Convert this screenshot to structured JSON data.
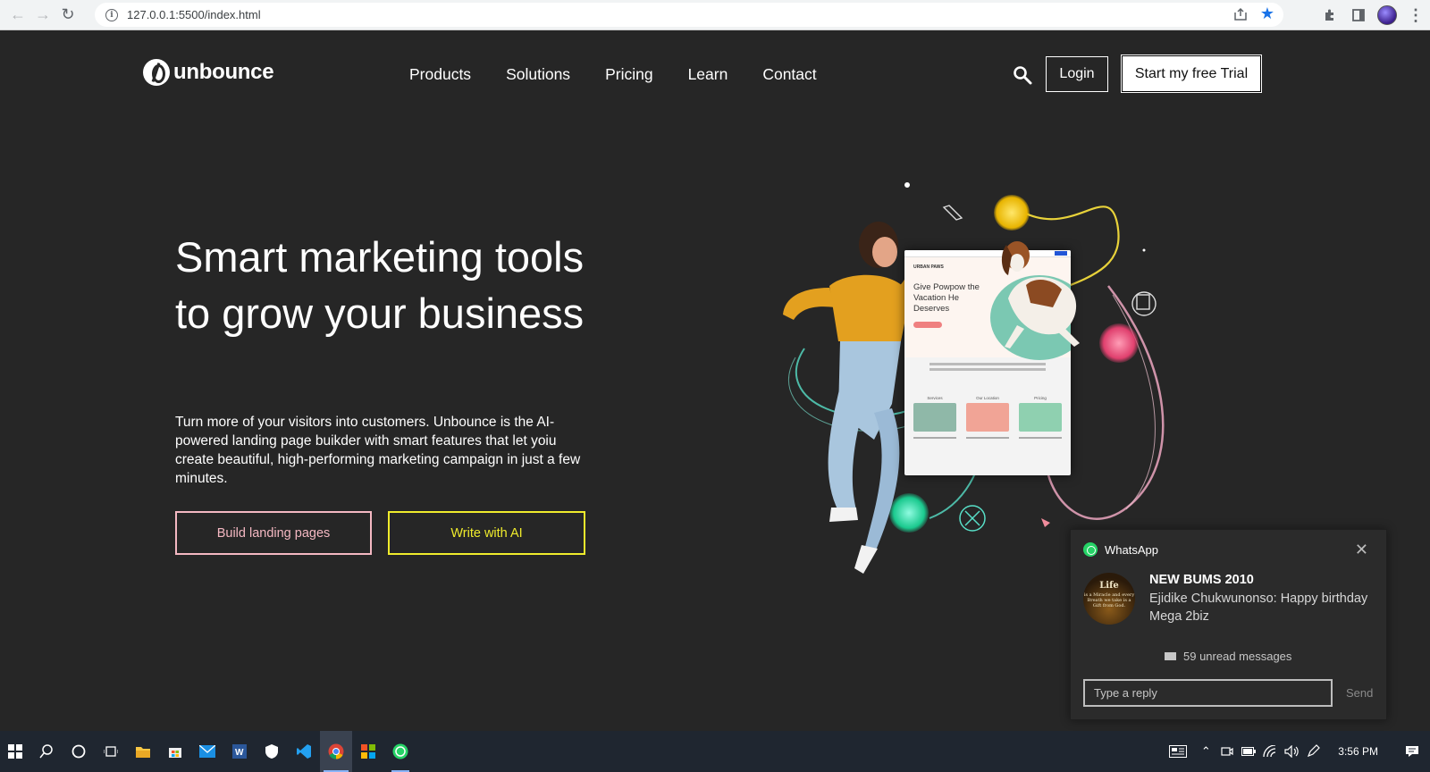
{
  "browser": {
    "url": "127.0.0.1:5500/index.html"
  },
  "site": {
    "logo_text": "unbounce",
    "nav": [
      "Products",
      "Solutions",
      "Pricing",
      "Learn",
      "Contact"
    ],
    "login_label": "Login",
    "trial_label": "Start my free Trial"
  },
  "hero": {
    "title": "Smart marketing tools to grow your business",
    "subtitle": "Turn more of your visitors into customers. Unbounce is the AI-powered landing page buikder with smart features that let yoiu create beautiful, high-performing marketing campaign in just a few minutes.",
    "btn_landing": "Build landing pages",
    "btn_ai": "Write with AI",
    "mockup_headline": "Give Powpow the Vacation He Deserves",
    "mockup_brand": "URBAN PAWS",
    "mockup_tiles": [
      "Services",
      "Our Location",
      "Pricing"
    ]
  },
  "notification": {
    "app": "WhatsApp",
    "title": "NEW BUMS 2010",
    "body": "Ejidike Chukwunonso: Happy birthday Mega 2biz",
    "unread": "59 unread messages",
    "reply_placeholder": "Type a reply",
    "send_label": "Send",
    "avatar_text": "Life",
    "avatar_subtext": "is a Miracle and every Breath we take is a Gift from God."
  },
  "taskbar": {
    "time": "3:56 PM"
  },
  "colors": {
    "page_bg": "#262626",
    "landing_btn": "#f4b8c2",
    "ai_btn": "#f0ec2c",
    "whatsapp_green": "#25d366",
    "taskbar_bg": "#1f2630"
  }
}
